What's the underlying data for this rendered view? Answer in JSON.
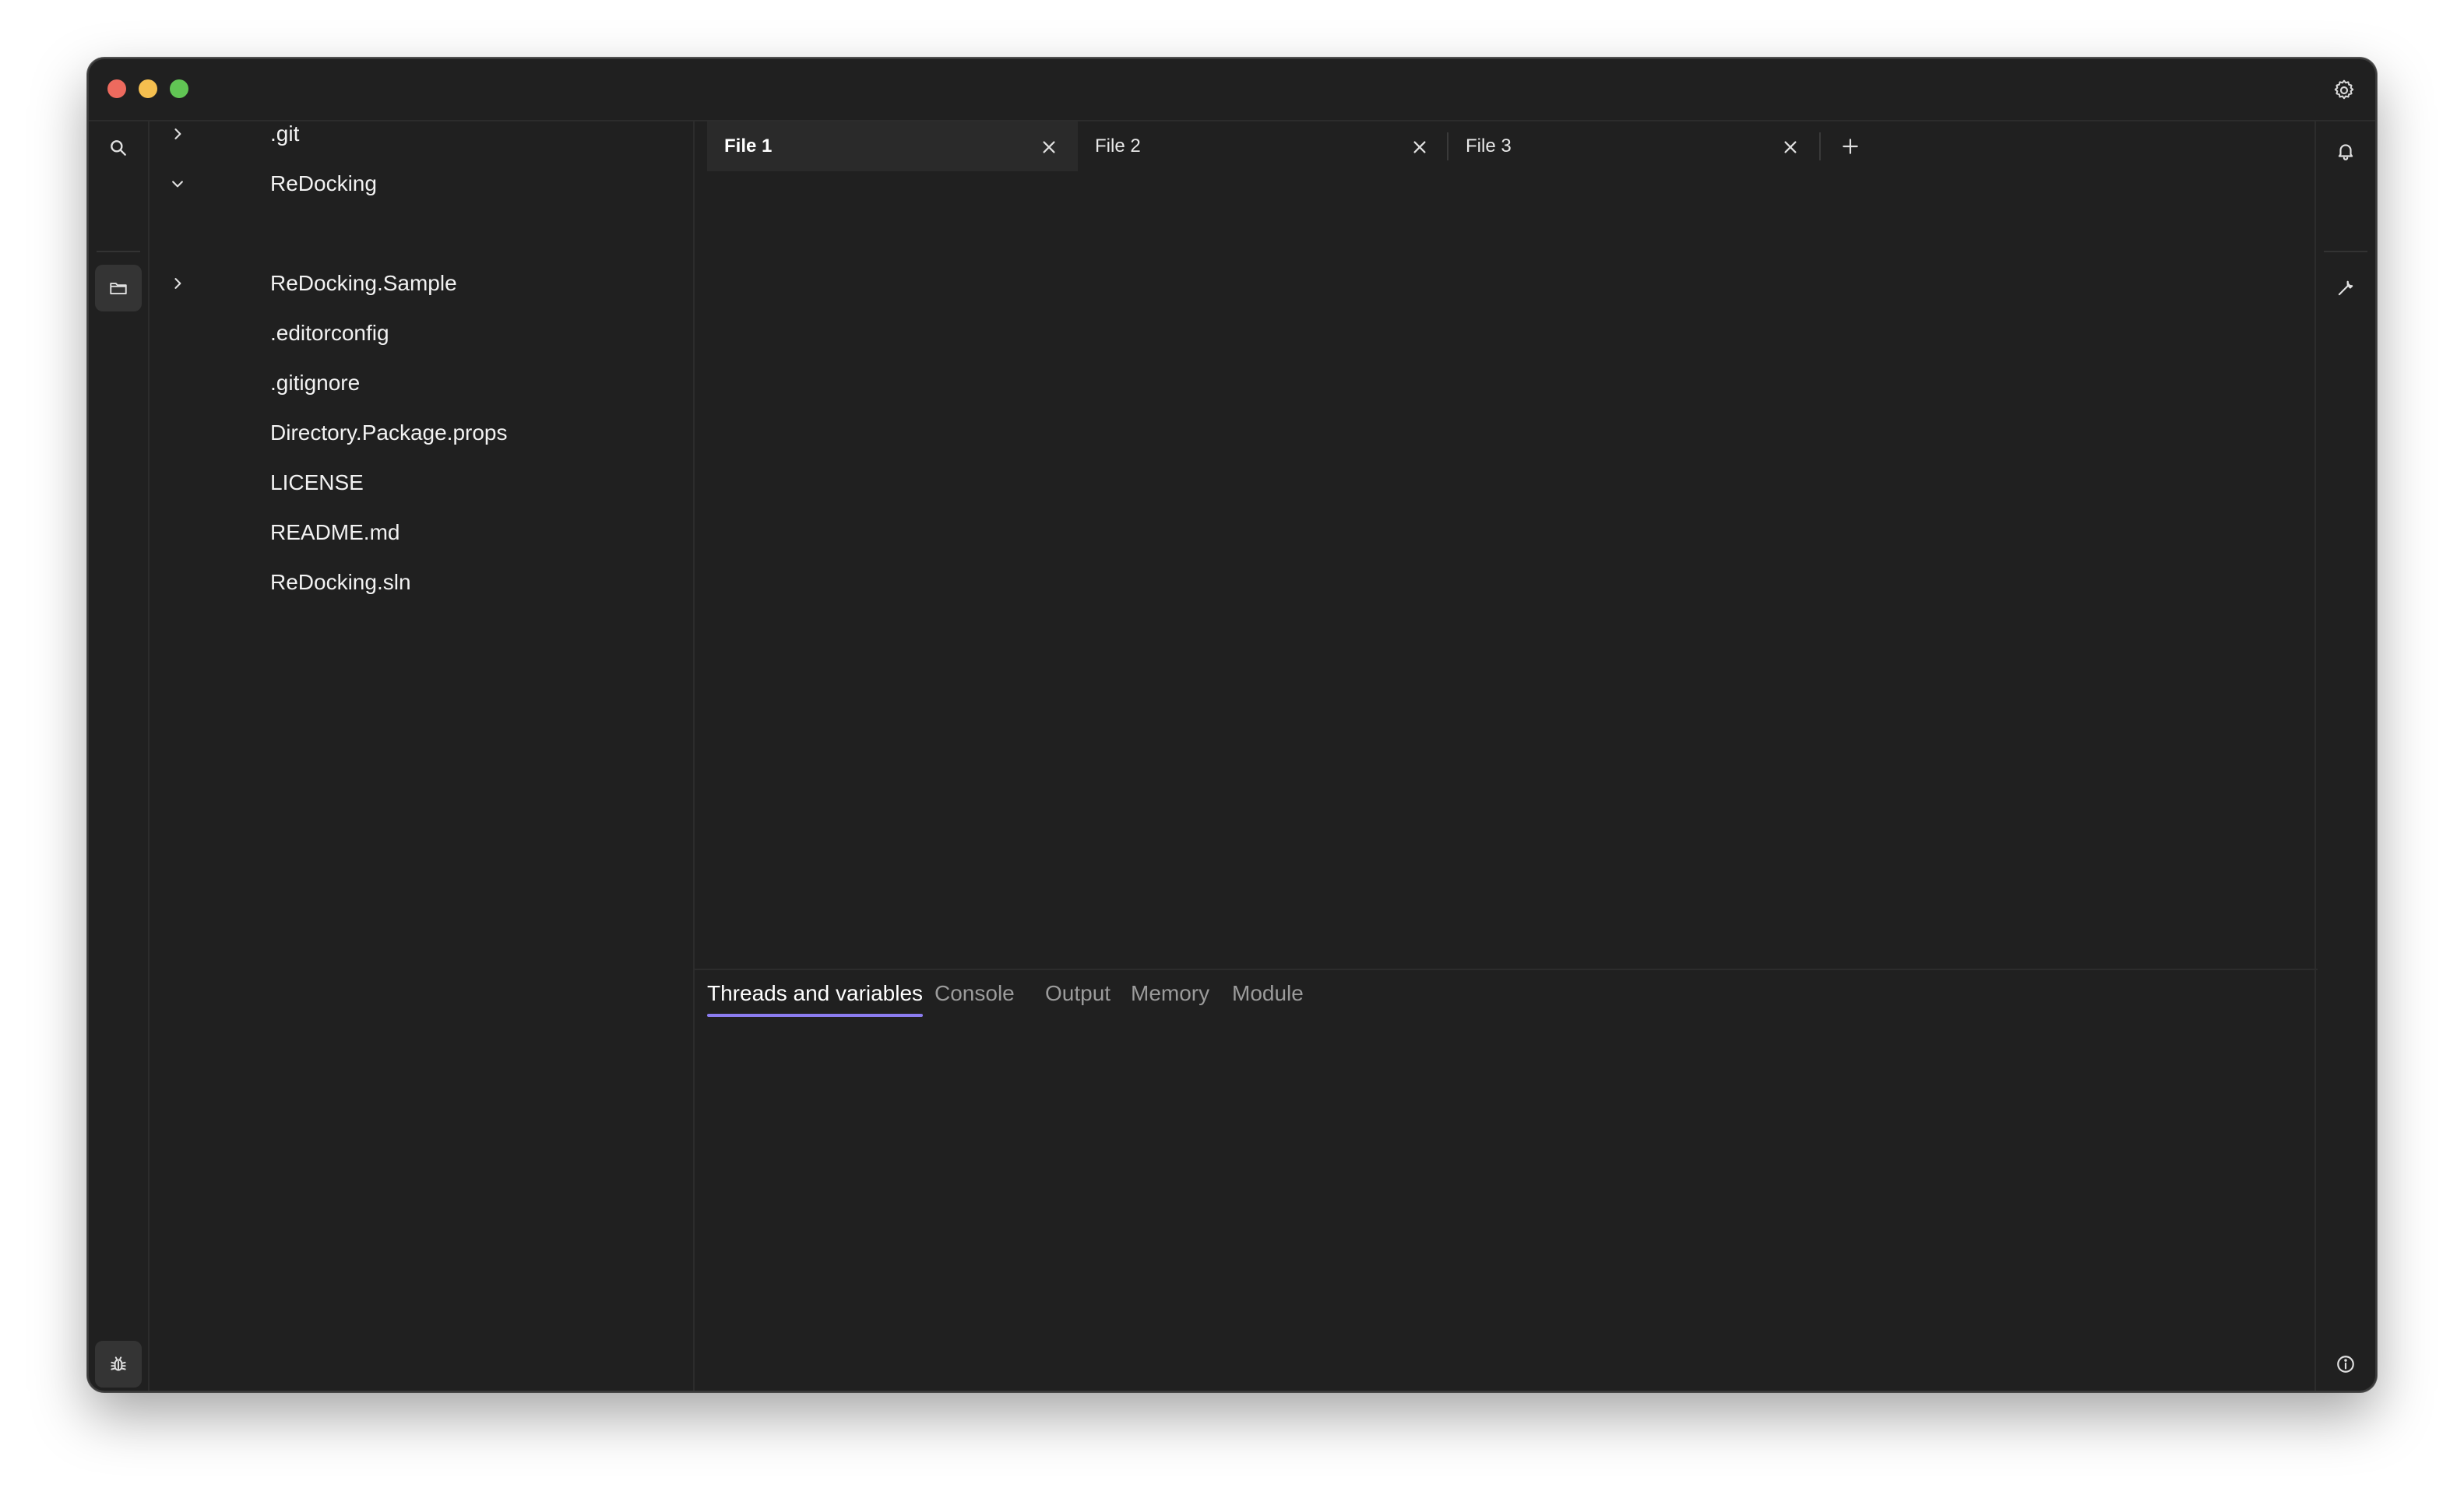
{
  "window": {
    "controls": {
      "close_color": "#ed6a5e",
      "minimize_color": "#f5bf4f",
      "maximize_color": "#61c554"
    },
    "titlebar_icon": "gear-icon"
  },
  "activity_bar_left": {
    "items": [
      {
        "icon": "search-icon",
        "active": false
      },
      {
        "icon": "folder-icon",
        "active": true
      }
    ],
    "bottom": {
      "icon": "bug-icon",
      "active": true
    }
  },
  "explorer": {
    "items": [
      {
        "label": ".git",
        "chevron": "right"
      },
      {
        "label": "ReDocking",
        "chevron": "down"
      },
      {
        "label": "ReDocking.Sample",
        "chevron": "right"
      },
      {
        "label": ".editorconfig",
        "chevron": null
      },
      {
        "label": ".gitignore",
        "chevron": null
      },
      {
        "label": "Directory.Package.props",
        "chevron": null
      },
      {
        "label": "LICENSE",
        "chevron": null
      },
      {
        "label": "README.md",
        "chevron": null
      },
      {
        "label": "ReDocking.sln",
        "chevron": null
      }
    ]
  },
  "editor": {
    "tabs": [
      {
        "label": "File 1",
        "active": true
      },
      {
        "label": "File 2",
        "active": false
      },
      {
        "label": "File 3",
        "active": false
      }
    ],
    "add_tab_icon": "plus-icon"
  },
  "bottom_panel": {
    "tabs": [
      {
        "label": "Threads and variables",
        "active": true
      },
      {
        "label": "Console",
        "active": false
      },
      {
        "label": "Output",
        "active": false
      },
      {
        "label": "Memory",
        "active": false
      },
      {
        "label": "Module",
        "active": false
      }
    ],
    "accent_color": "#8b7cf0"
  },
  "activity_bar_right": {
    "items": [
      {
        "icon": "bell-icon"
      },
      {
        "icon": "wrench-icon"
      }
    ],
    "bottom": {
      "icon": "info-icon"
    }
  }
}
